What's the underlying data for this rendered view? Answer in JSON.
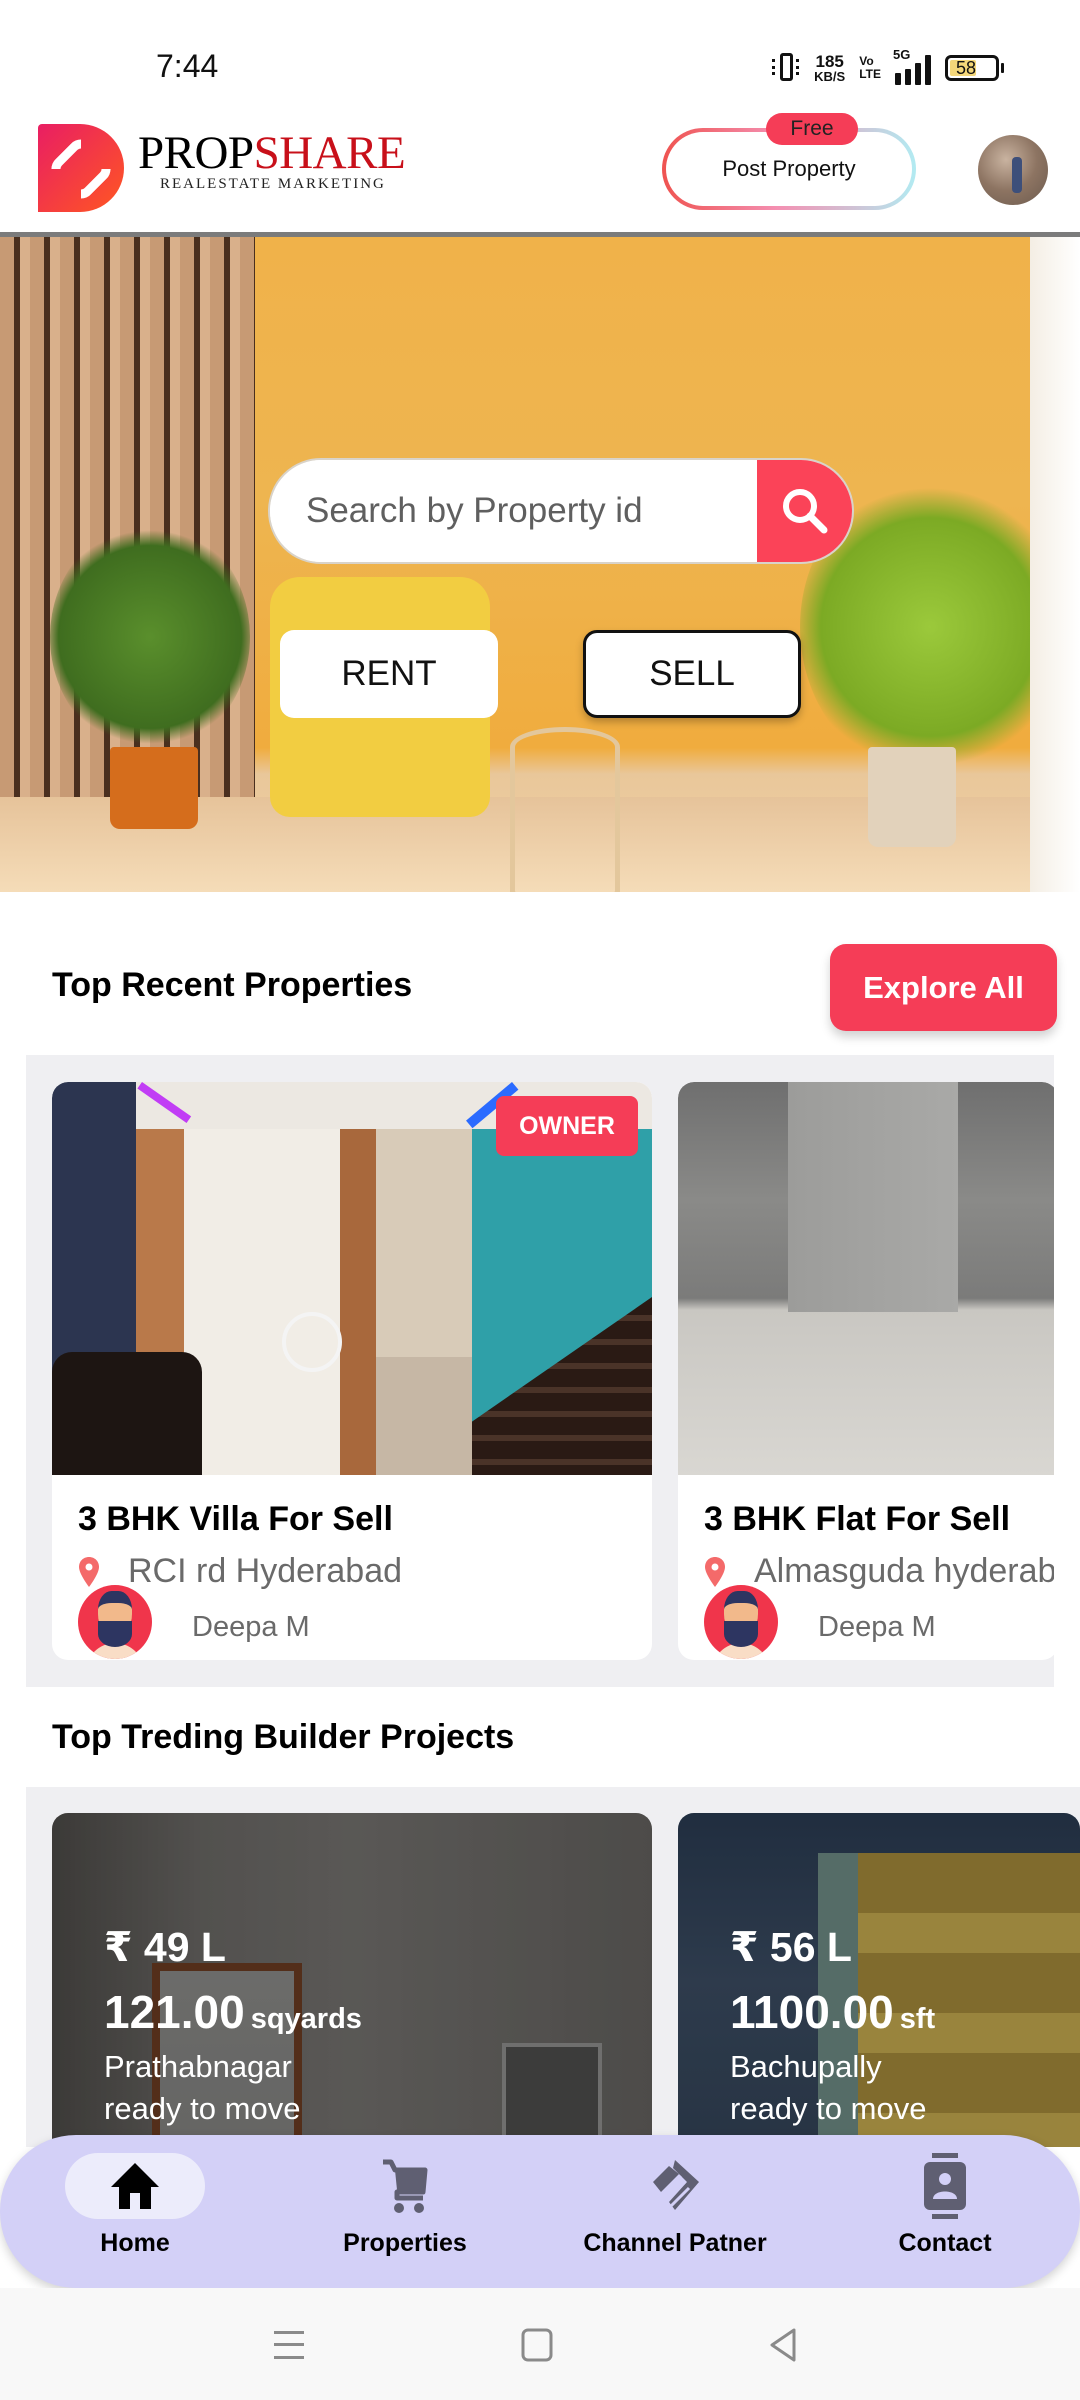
{
  "status_bar": {
    "time": "7:44",
    "net_speed_value": "185",
    "net_speed_unit": "KB/S",
    "volte_top": "Vo",
    "volte_bottom": "LTE",
    "network": "5G",
    "battery_level": "58",
    "battery_color": "#f4d77a"
  },
  "header": {
    "logo_title_part1": "PROP",
    "logo_title_part2": "SHARE",
    "logo_subtitle": "REALESTATE MARKETING",
    "post_property_label": "Post Property",
    "free_badge": "Free",
    "avatar_alt": "user profile photo"
  },
  "hero": {
    "search_placeholder": "Search by Property id",
    "search_value": "",
    "rent_label": "RENT",
    "sell_label": "SELL",
    "selected_mode": "SELL"
  },
  "recent": {
    "title": "Top Recent Properties",
    "explore_label": "Explore All",
    "cards": [
      {
        "badge": "OWNER",
        "title": "3 BHK Villa For Sell",
        "location": "RCI rd Hyderabad",
        "owner": "Deepa M"
      },
      {
        "badge": "",
        "title": "3 BHK Flat For Sell",
        "location": "Almasguda hyderabad",
        "owner": "Deepa M"
      }
    ]
  },
  "builder": {
    "title": "Top Treding Builder Projects",
    "cards": [
      {
        "price": "₹ 49 L",
        "area": "121.00",
        "unit": "sqyards",
        "location": "Prathabnagar",
        "status": "ready to move"
      },
      {
        "price": "₹ 56 L",
        "area": "1100.00",
        "unit": "sft",
        "location": "Bachupally",
        "status": "ready to move"
      }
    ]
  },
  "bottom_nav": {
    "active": "Home",
    "items": [
      {
        "label": "Home",
        "icon": "home-icon"
      },
      {
        "label": "Properties",
        "icon": "cart-icon"
      },
      {
        "label": "Channel Patner",
        "icon": "handshake-icon"
      },
      {
        "label": "Contact",
        "icon": "contact-card-icon"
      }
    ]
  },
  "colors": {
    "accent": "#f53d57",
    "search_button": "#fb4358",
    "nav_background": "#d3d0f7",
    "panel_background": "#efeff2",
    "logo_red": "#c8101a"
  }
}
